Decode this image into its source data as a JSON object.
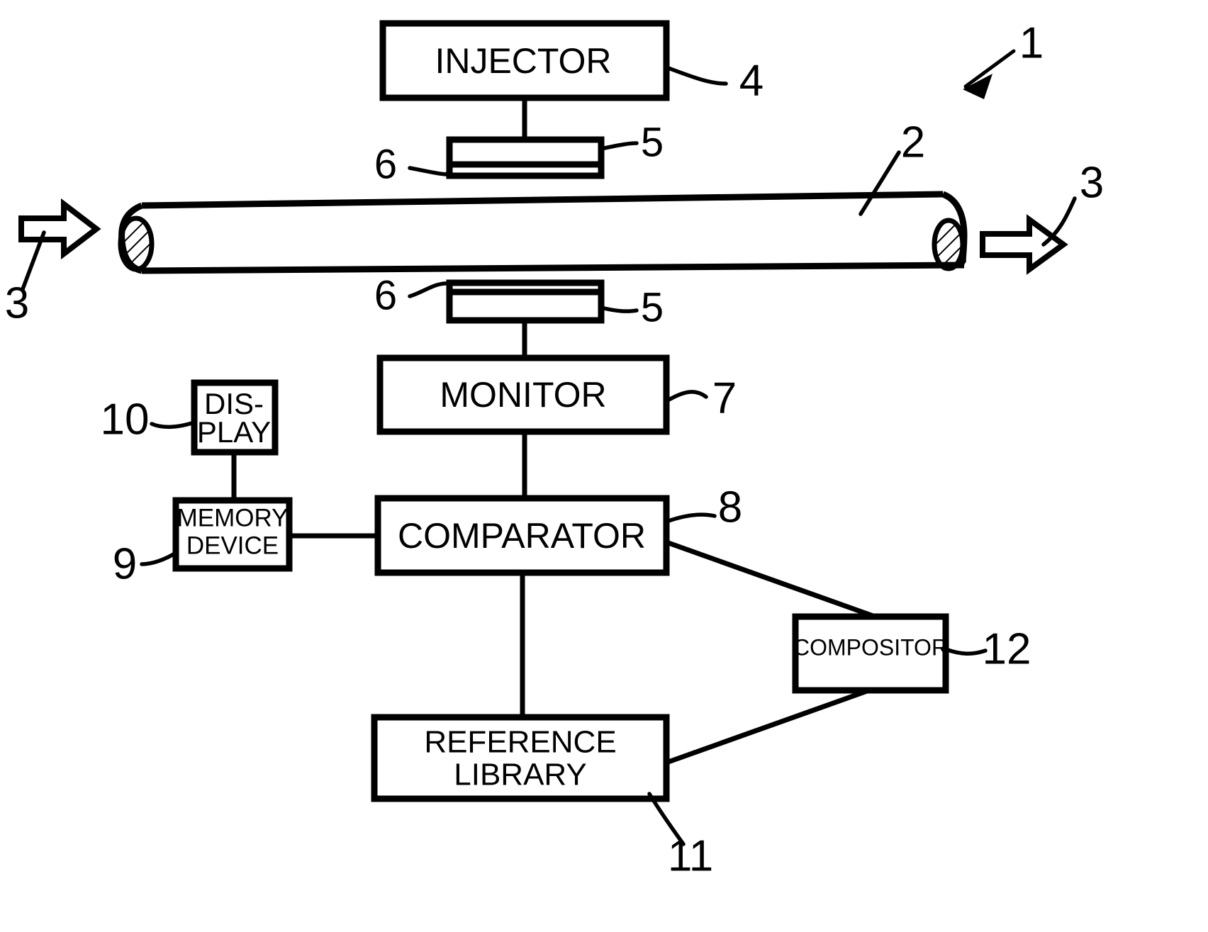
{
  "figure": {
    "type": "patent-block-diagram",
    "background_color": "#ffffff",
    "line_color": "#000000"
  },
  "boxes": {
    "injector": {
      "label": "INJECTOR",
      "ref": "4"
    },
    "monitor": {
      "label": "MONITOR",
      "ref": "7"
    },
    "display": {
      "label_line1": "DIS-",
      "label_line2": "PLAY",
      "ref": "10"
    },
    "memory_device": {
      "label_line1": "MEMORY",
      "label_line2": "DEVICE",
      "ref": "9"
    },
    "comparator": {
      "label": "COMPARATOR",
      "ref": "8"
    },
    "reference_library": {
      "label_line1": "REFERENCE",
      "label_line2": "LIBRARY",
      "ref": "11"
    },
    "compositor": {
      "label": "COMPOSITOR",
      "ref": "12"
    }
  },
  "reference_numerals": {
    "system": "1",
    "pipe": "2",
    "flow_left": "3",
    "flow_right": "3",
    "injector": "4",
    "transducer_top": "5",
    "couplant_top": "6",
    "transducer_bottom": "5",
    "couplant_bottom": "6",
    "monitor": "7",
    "comparator": "8",
    "memory_device": "9",
    "display": "10",
    "reference_library": "11",
    "compositor": "12"
  },
  "elements": {
    "pipe_name": "pipe",
    "transducer_top_name": "ultrasonic-transducer-top",
    "transducer_bottom_name": "ultrasonic-transducer-bottom",
    "flow_arrow_left_name": "flow-arrow-left",
    "flow_arrow_right_name": "flow-arrow-right",
    "system_pointer_name": "system-pointer-arrow"
  }
}
